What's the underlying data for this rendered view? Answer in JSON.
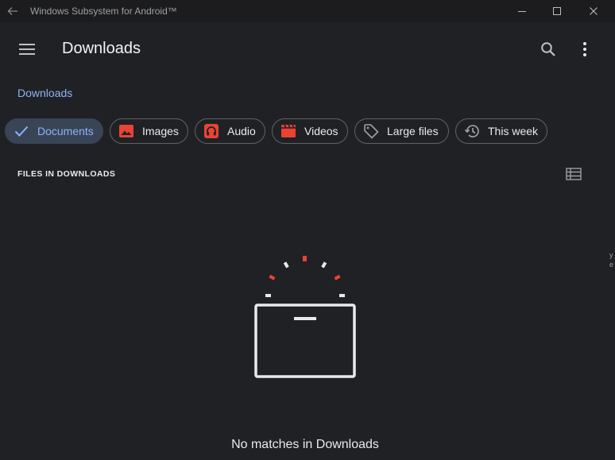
{
  "window": {
    "title": "Windows Subsystem for Android™"
  },
  "appbar": {
    "title": "Downloads"
  },
  "breadcrumb": {
    "label": "Downloads"
  },
  "chips": [
    {
      "label": "Documents",
      "icon": "check-icon",
      "selected": true
    },
    {
      "label": "Images",
      "icon": "image-icon",
      "selected": false
    },
    {
      "label": "Audio",
      "icon": "headphones-icon",
      "selected": false
    },
    {
      "label": "Videos",
      "icon": "movie-icon",
      "selected": false
    },
    {
      "label": "Large files",
      "icon": "tag-icon",
      "selected": false
    },
    {
      "label": "This week",
      "icon": "history-icon",
      "selected": false
    }
  ],
  "section": {
    "header": "FILES IN DOWNLOADS"
  },
  "empty_state": {
    "message": "No matches in Downloads"
  },
  "edge_text": [
    "y",
    "e"
  ],
  "colors": {
    "background": "#202124",
    "titlebar": "#1c1c1e",
    "accent": "#8ab4f8",
    "selected_chip": "#394457",
    "icon_red": "#ea4335",
    "outline": "#5f6368"
  }
}
